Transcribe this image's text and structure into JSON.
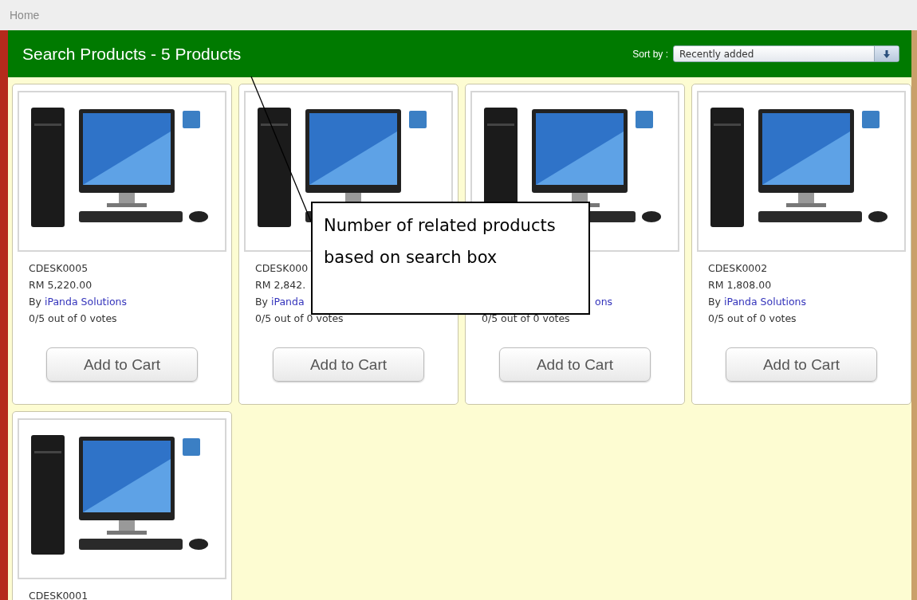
{
  "breadcrumb": "Home",
  "header": {
    "title": "Search Products - 5 Products",
    "sort_label": "Sort by :",
    "sort_value": "Recently added"
  },
  "products": [
    {
      "code": "CDESK0005",
      "price": "RM 5,220.00",
      "by": "By",
      "vendor": "iPanda Solutions",
      "votes": "0/5 out of 0 votes",
      "button": "Add to Cart"
    },
    {
      "code": "CDESK000",
      "price": "RM 2,842.",
      "by": "By",
      "vendor": "iPanda",
      "votes": "0/5 out of 0 votes",
      "button": "Add to Cart"
    },
    {
      "vendor": "ons",
      "votes": "0/5 out of 0 votes",
      "button": "Add to Cart"
    },
    {
      "code": "CDESK0002",
      "price": "RM 1,808.00",
      "by": "By",
      "vendor": "iPanda Solutions",
      "votes": "0/5 out of 0 votes",
      "button": "Add to Cart"
    },
    {
      "code": "CDESK0001"
    }
  ],
  "callout": {
    "text": "Number of related products based on search box"
  }
}
